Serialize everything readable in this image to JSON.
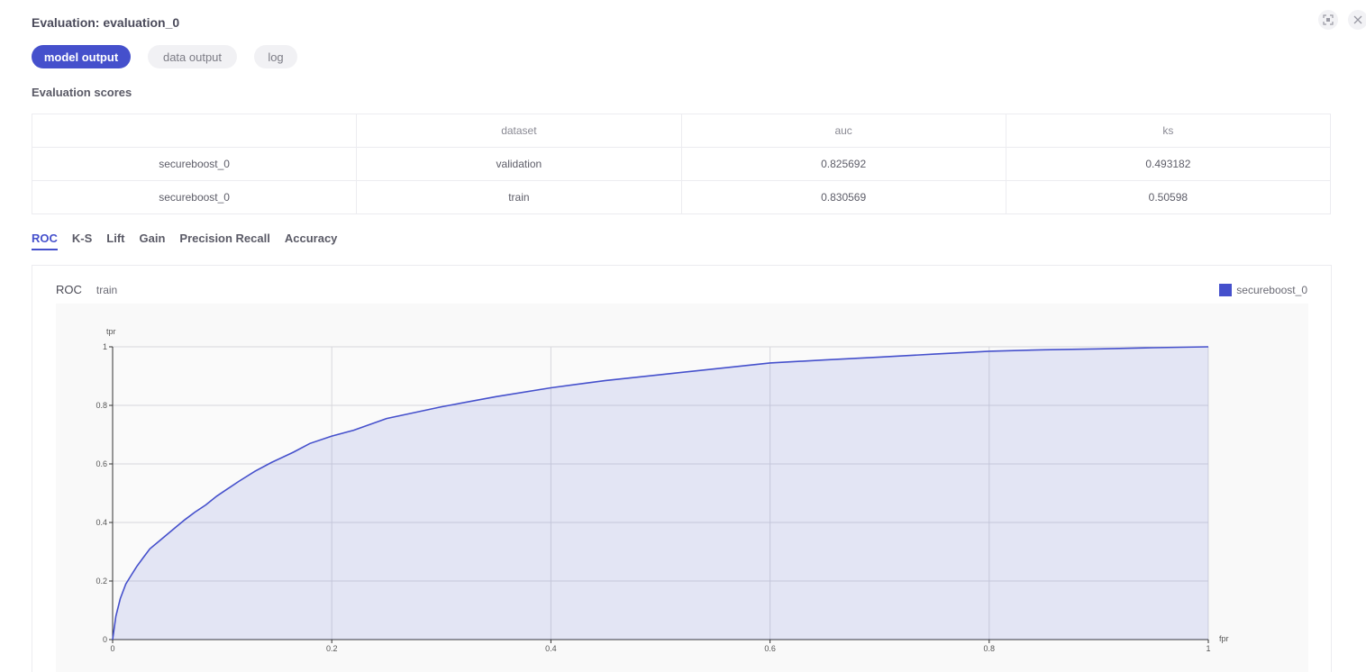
{
  "header": {
    "title": "Evaluation: evaluation_0"
  },
  "pills": {
    "model_output": "model output",
    "data_output": "data output",
    "log": "log"
  },
  "scores": {
    "title": "Evaluation scores",
    "columns": [
      "",
      "dataset",
      "auc",
      "ks"
    ],
    "rows": [
      [
        "secureboost_0",
        "validation",
        "0.825692",
        "0.493182"
      ],
      [
        "secureboost_0",
        "train",
        "0.830569",
        "0.50598"
      ]
    ]
  },
  "tabs": [
    "ROC",
    "K-S",
    "Lift",
    "Gain",
    "Precision Recall",
    "Accuracy"
  ],
  "chart": {
    "name": "ROC",
    "subset": "train",
    "legend": "secureboost_0"
  },
  "chart_data": {
    "type": "area",
    "title": "ROC",
    "subtitle": "train",
    "xlabel": "fpr",
    "ylabel": "tpr",
    "xlim": [
      0,
      1
    ],
    "ylim": [
      0,
      1
    ],
    "xticks": [
      "0",
      "0.2",
      "0.4",
      "0.6",
      "0.8",
      "1"
    ],
    "yticks": [
      "0",
      "0.2",
      "0.4",
      "0.6",
      "0.8",
      "1"
    ],
    "grid": true,
    "legend_position": "top-right",
    "series": [
      {
        "name": "secureboost_0",
        "color": "#4550cc",
        "x": [
          0,
          0.003,
          0.007,
          0.012,
          0.017,
          0.022,
          0.028,
          0.034,
          0.042,
          0.05,
          0.058,
          0.066,
          0.075,
          0.085,
          0.095,
          0.105,
          0.115,
          0.13,
          0.145,
          0.165,
          0.18,
          0.2,
          0.22,
          0.25,
          0.275,
          0.3,
          0.35,
          0.4,
          0.45,
          0.5,
          0.55,
          0.6,
          0.65,
          0.7,
          0.75,
          0.8,
          0.85,
          0.9,
          0.95,
          1.0
        ],
        "y": [
          0,
          0.08,
          0.14,
          0.19,
          0.22,
          0.25,
          0.28,
          0.31,
          0.335,
          0.36,
          0.385,
          0.41,
          0.435,
          0.46,
          0.49,
          0.515,
          0.54,
          0.575,
          0.605,
          0.64,
          0.67,
          0.695,
          0.715,
          0.755,
          0.775,
          0.795,
          0.83,
          0.86,
          0.885,
          0.905,
          0.925,
          0.945,
          0.955,
          0.965,
          0.975,
          0.985,
          0.99,
          0.993,
          0.997,
          1.0
        ]
      }
    ]
  }
}
